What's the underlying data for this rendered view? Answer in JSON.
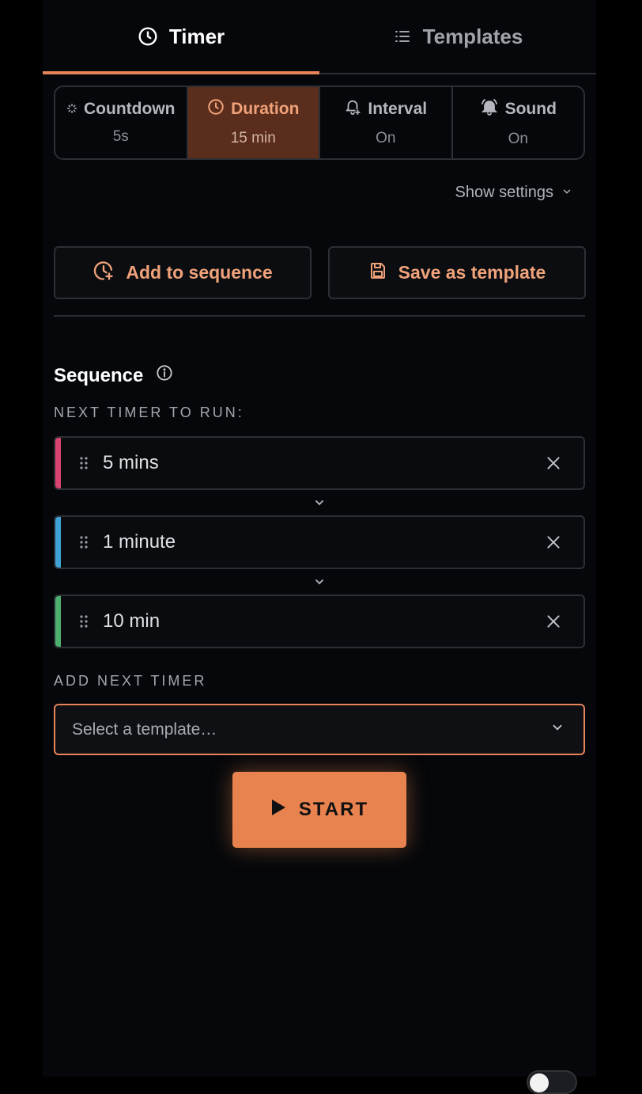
{
  "tabs": [
    {
      "label": "Timer",
      "icon": "clock-icon",
      "active": true
    },
    {
      "label": "Templates",
      "icon": "list-icon",
      "active": false
    }
  ],
  "options": [
    {
      "label": "Countdown",
      "value": "5s",
      "icon": "spinner-icon",
      "active": false
    },
    {
      "label": "Duration",
      "value": "15 min",
      "icon": "clock-icon",
      "active": true
    },
    {
      "label": "Interval",
      "value": "On",
      "icon": "bell-plus-icon",
      "active": false
    },
    {
      "label": "Sound",
      "value": "On",
      "icon": "bell-ring-icon",
      "active": false
    }
  ],
  "show_settings": "Show settings",
  "actions": {
    "add_to_sequence": "Add to sequence",
    "save_as_template": "Save as template"
  },
  "sequence": {
    "title": "Sequence",
    "next_label": "NEXT TIMER TO RUN:",
    "items": [
      {
        "label": "5 mins",
        "color": "#d8436f"
      },
      {
        "label": "1 minute",
        "color": "#3fa3d6"
      },
      {
        "label": "10 min",
        "color": "#4caf6e"
      }
    ],
    "add_label": "ADD NEXT TIMER",
    "select_placeholder": "Select a template…"
  },
  "start_label": "START",
  "colors": {
    "accent": "#e8845a",
    "active_segment": "#5a2d1c"
  }
}
